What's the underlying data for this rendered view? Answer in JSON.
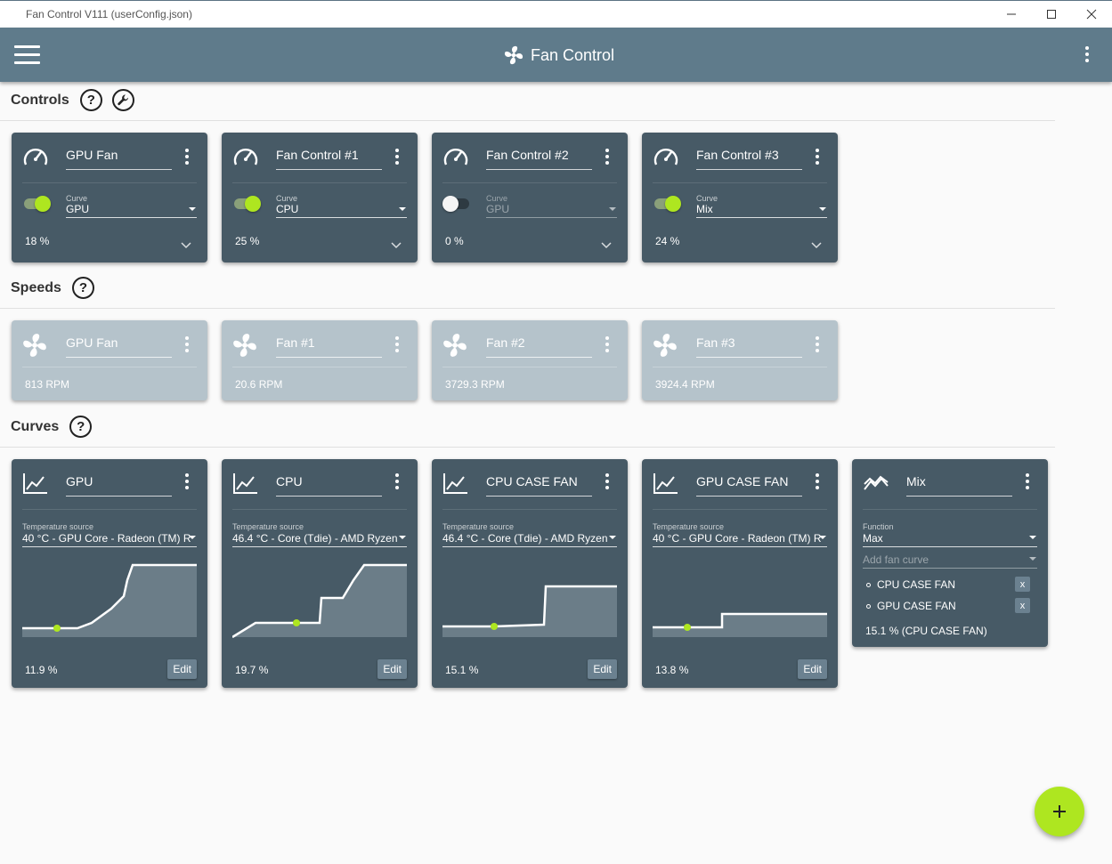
{
  "window": {
    "title": "Fan Control V111 (userConfig.json)"
  },
  "appbar": {
    "title": "Fan Control",
    "menu_icon": "hamburger-menu-icon",
    "more_icon": "more-vertical-icon"
  },
  "sections": {
    "controls": "Controls",
    "speeds": "Speeds",
    "curves": "Curves",
    "help_glyph": "?"
  },
  "controls": [
    {
      "name": "GPU Fan",
      "curve_label": "Curve",
      "curve": "GPU",
      "enabled": true,
      "percent": "18 %"
    },
    {
      "name": "Fan Control #1",
      "curve_label": "Curve",
      "curve": "CPU",
      "enabled": true,
      "percent": "25 %"
    },
    {
      "name": "Fan Control #2",
      "curve_label": "Curve",
      "curve": "GPU",
      "enabled": false,
      "percent": "0 %"
    },
    {
      "name": "Fan Control #3",
      "curve_label": "Curve",
      "curve": "Mix",
      "enabled": true,
      "percent": "24 %"
    }
  ],
  "speeds": [
    {
      "name": "GPU Fan",
      "rpm": "813 RPM"
    },
    {
      "name": "Fan #1",
      "rpm": "20.6 RPM"
    },
    {
      "name": "Fan #2",
      "rpm": "3729.3 RPM"
    },
    {
      "name": "Fan #3",
      "rpm": "3924.4 RPM"
    }
  ],
  "curves": [
    {
      "name": "GPU",
      "source_label": "Temperature source",
      "source": "40 °C - GPU Core - Radeon (TM) R",
      "output": "11.9 %",
      "edit": "Edit"
    },
    {
      "name": "CPU",
      "source_label": "Temperature source",
      "source": "46.4 °C - Core (Tdie) - AMD Ryzen",
      "output": "19.7 %",
      "edit": "Edit"
    },
    {
      "name": "CPU CASE FAN",
      "source_label": "Temperature source",
      "source": "46.4 °C - Core (Tdie) - AMD Ryzen",
      "output": "15.1 %",
      "edit": "Edit"
    },
    {
      "name": "GPU CASE FAN",
      "source_label": "Temperature source",
      "source": "40 °C - GPU Core - Radeon (TM) R",
      "output": "13.8 %",
      "edit": "Edit"
    }
  ],
  "mix": {
    "name": "Mix",
    "function_label": "Function",
    "function": "Max",
    "add_placeholder": "Add fan curve",
    "items": [
      "CPU CASE FAN",
      "GPU CASE FAN"
    ],
    "remove_glyph": "x",
    "output": "15.1 % (CPU CASE FAN)"
  },
  "colors": {
    "appbar": "#5f7b8b",
    "card_dark": "#475a66",
    "card_light": "#b5c3cb",
    "accent": "#aee620"
  }
}
